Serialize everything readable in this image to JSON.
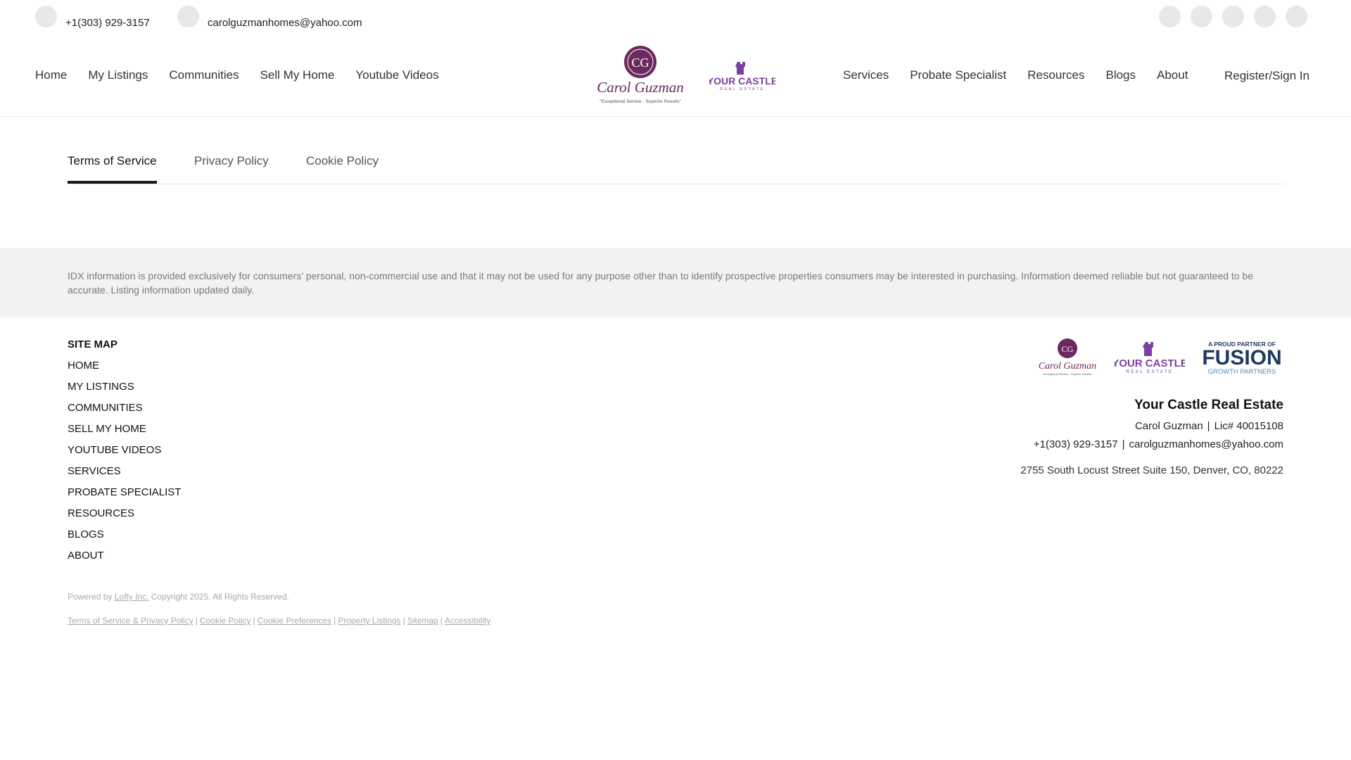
{
  "header": {
    "phone": "+1(303) 929-3157",
    "email": "carolguzmanhomes@yahoo.com",
    "social_icons": [
      "social-icon",
      "social-icon",
      "social-icon",
      "social-icon",
      "social-icon"
    ],
    "nav_left": [
      "Home",
      "My Listings",
      "Communities",
      "Sell My Home",
      "Youtube Videos"
    ],
    "nav_right": [
      "Services",
      "Probate Specialist",
      "Resources",
      "Blogs",
      "About"
    ],
    "register": "Register/Sign In",
    "logo": {
      "monogram": "CG",
      "name": "Carol Guzman",
      "tagline": "\"Exceptional Service - Superior Results\""
    },
    "partner_logo": {
      "line1": "YOUR CASTLE",
      "line2": "REAL ESTATE"
    }
  },
  "tabs": [
    "Terms of Service",
    "Privacy Policy",
    "Cookie Policy"
  ],
  "active_tab": "Terms of Service",
  "idx_disclaimer": "IDX information is provided exclusively for consumers’ personal, non-commercial use and that it may not be used for any purpose other than to identify prospective properties consumers may be interested in purchasing. Information deemed reliable but not guaranteed to be accurate. Listing information updated daily.",
  "footer": {
    "sitemap_title": "SITE MAP",
    "sitemap_links": [
      "HOME",
      "MY LISTINGS",
      "COMMUNITIES",
      "SELL MY HOME",
      "YOUTUBE VIDEOS",
      "SERVICES",
      "PROBATE SPECIALIST",
      "RESOURCES",
      "BLOGS",
      "ABOUT"
    ],
    "powered_prefix": "Powered by",
    "powered_link": "Lofty Inc.",
    "copyright": "Copyright 2025. All Rights Reserved.",
    "legal_links": [
      "Terms of Service & Privacy Policy",
      "Cookie Policy",
      "Cookie Preferences",
      "Property Listings",
      "Sitemap",
      "Accessibility"
    ],
    "legal_separator": "|",
    "brokerage": "Your Castle Real Estate",
    "agent": "Carol Guzman",
    "license": "Lic# 40015108",
    "phone": "+1(303) 929-3157",
    "email": "carolguzmanhomes@yahoo.com",
    "address": "2755 South Locust Street Suite 150, Denver, CO, 80222",
    "separator": "|",
    "fusion_logo": {
      "top": "A PROUD PARTNER OF",
      "main": "FUSION",
      "bottom": "GROWTH PARTNERS"
    }
  },
  "colors": {
    "brand_purple": "#6b2a5e",
    "castle_purple": "#7b3fa0",
    "fusion_navy": "#1f3a5f",
    "fusion_blue": "#4a8fc9",
    "idx_band": "#f2f2f2"
  }
}
